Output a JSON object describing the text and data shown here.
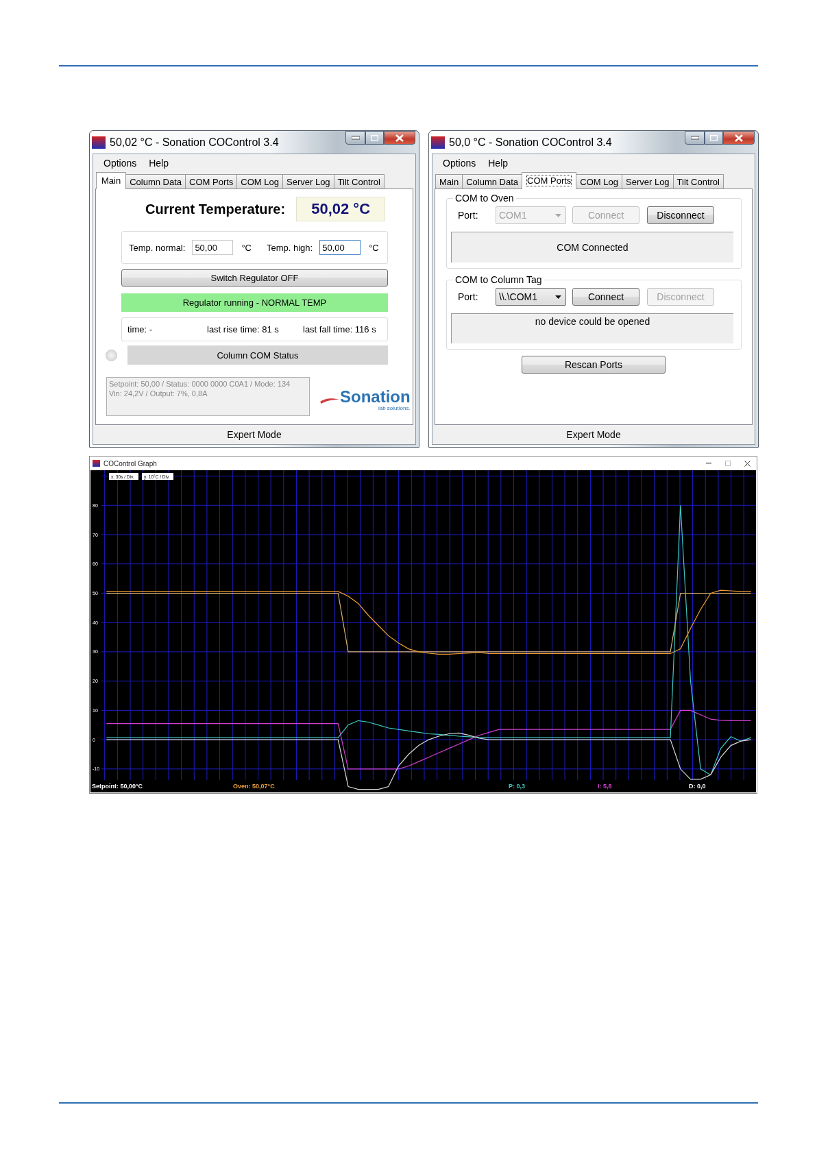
{
  "windows": [
    {
      "kind": "main",
      "title": "50,02 °C - Sonation COControl 3.4",
      "menu": [
        "Options",
        "Help"
      ],
      "tabs": [
        {
          "label": "Main",
          "selected": true
        },
        {
          "label": "Column Data",
          "selected": false
        },
        {
          "label": "COM Ports",
          "selected": false
        },
        {
          "label": "COM Log",
          "selected": false
        },
        {
          "label": "Server Log",
          "selected": false
        },
        {
          "label": "Tilt Control",
          "selected": false
        }
      ],
      "current_temperature": {
        "label": "Current Temperature:",
        "value": "50,02 °C"
      },
      "setpoints": [
        {
          "label": "Temp. normal:",
          "value": "50,00",
          "unit": "°C",
          "focused": false
        },
        {
          "label": "Temp. high:",
          "value": "50,00",
          "unit": "°C",
          "focused": true
        }
      ],
      "regulator_button": "Switch Regulator OFF",
      "regulator_status": {
        "text": "Regulator running - NORMAL TEMP",
        "running": true
      },
      "timing": [
        "time: -",
        "last rise time: 81 s",
        "last fall time: 116 s"
      ],
      "column_status": {
        "led_on": false,
        "label": "Column COM Status"
      },
      "info_lines": [
        "Setpoint: 50,00 / Status: 0000 0000 C0A1 / Mode: 134",
        "Vin: 24,2V / Output: 7%, 0,8A"
      ],
      "logo": {
        "name": "Sonation",
        "tagline": "lab solutions."
      },
      "footer": "Expert Mode"
    },
    {
      "kind": "com_ports",
      "title": "50,0 °C - Sonation COControl 3.4",
      "menu": [
        "Options",
        "Help"
      ],
      "tabs": [
        {
          "label": "Main",
          "selected": false
        },
        {
          "label": "Column Data",
          "selected": false
        },
        {
          "label": "COM Ports",
          "selected": true
        },
        {
          "label": "COM Log",
          "selected": false
        },
        {
          "label": "Server Log",
          "selected": false
        },
        {
          "label": "Tilt Control",
          "selected": false
        }
      ],
      "groups": [
        {
          "title": "COM to Oven",
          "port_label": "Port:",
          "port": {
            "value": "COM1",
            "disabled": true
          },
          "connect": {
            "label": "Connect",
            "disabled": true
          },
          "disconnect": {
            "label": "Disconnect",
            "disabled": false
          },
          "status": "COM Connected"
        },
        {
          "title": "COM to Column Tag",
          "port_label": "Port:",
          "port": {
            "value": "\\\\.\\COM1",
            "disabled": false
          },
          "connect": {
            "label": "Connect",
            "disabled": false
          },
          "disconnect": {
            "label": "Disconnect",
            "disabled": true
          },
          "status": "no device could be opened"
        }
      ],
      "rescan_button": "Rescan Ports",
      "footer": "Expert Mode"
    }
  ],
  "graph": {
    "title": "COControl Graph",
    "scale_labels": [
      "x: 30s / Div.",
      "y: 10°C / Div."
    ],
    "chart_data": {
      "type": "line",
      "grid": true,
      "ylim": [
        -18,
        92
      ],
      "yticks": [
        -10,
        0,
        10,
        20,
        30,
        40,
        50,
        60,
        70,
        80
      ],
      "categories": [
        null,
        null,
        null,
        null,
        null,
        null,
        null,
        null,
        null,
        null,
        null,
        null,
        null,
        null,
        null,
        null,
        null,
        null,
        null,
        null,
        null,
        null,
        null,
        null,
        null,
        null,
        null,
        null,
        null,
        null,
        null,
        null,
        null,
        null,
        null,
        null,
        null,
        null,
        null,
        null,
        null,
        null,
        null,
        null,
        null,
        null,
        null,
        null,
        null,
        null,
        null,
        null,
        null,
        null,
        null,
        null,
        null,
        null,
        null,
        null,
        null,
        null,
        null,
        null,
        null
      ],
      "series": [
        {
          "color": "#d8b070",
          "values": [
            50,
            50,
            50,
            50,
            50,
            50,
            50,
            50,
            50,
            50,
            50,
            50,
            50,
            50,
            50,
            50,
            50,
            50,
            50,
            50,
            50,
            50,
            50,
            50,
            30,
            30,
            30,
            30,
            30,
            30,
            30,
            30,
            30,
            30,
            30,
            30,
            30,
            30,
            30,
            30,
            30,
            30,
            30,
            30,
            30,
            30,
            30,
            30,
            30,
            30,
            30,
            30,
            30,
            30,
            30,
            30,
            30,
            50,
            50,
            50,
            50,
            50,
            50,
            50,
            50
          ]
        },
        {
          "color": "#f0a030",
          "values": [
            50.6,
            50.6,
            50.6,
            50.6,
            50.6,
            50.6,
            50.6,
            50.6,
            50.6,
            50.6,
            50.6,
            50.6,
            50.6,
            50.6,
            50.6,
            50.6,
            50.6,
            50.6,
            50.6,
            50.6,
            50.6,
            50.6,
            50.6,
            50.6,
            49,
            46.5,
            42.5,
            39,
            35.5,
            33,
            31,
            30,
            29.5,
            29.2,
            29.2,
            29.4,
            29.6,
            29.8,
            29.4,
            29.4,
            29.4,
            29.4,
            29.4,
            29.4,
            29.4,
            29.4,
            29.4,
            29.4,
            29.4,
            29.4,
            29.4,
            29.4,
            29.4,
            29.4,
            29.4,
            29.4,
            29.4,
            31,
            38,
            44.5,
            50,
            51,
            50.8,
            50.6,
            50.6
          ]
        },
        {
          "color": "#d040d0",
          "values": [
            5.5,
            5.5,
            5.5,
            5.5,
            5.5,
            5.5,
            5.5,
            5.5,
            5.5,
            5.5,
            5.5,
            5.5,
            5.5,
            5.5,
            5.5,
            5.5,
            5.5,
            5.5,
            5.5,
            5.5,
            5.5,
            5.5,
            5.5,
            5.5,
            -10,
            -10,
            -10,
            -10,
            -10,
            -10,
            -9,
            -7.5,
            -6,
            -4.5,
            -3,
            -1.5,
            0,
            1.5,
            2.5,
            3.5,
            3.5,
            3.5,
            3.5,
            3.5,
            3.5,
            3.5,
            3.5,
            3.5,
            3.5,
            3.5,
            3.5,
            3.5,
            3.5,
            3.5,
            3.5,
            3.5,
            3.5,
            10,
            10,
            8.5,
            7,
            6.6,
            6.5,
            6.5,
            6.5
          ]
        },
        {
          "color": "#40c8c0",
          "values": [
            0.7,
            0.7,
            0.7,
            0.7,
            0.7,
            0.7,
            0.7,
            0.7,
            0.7,
            0.7,
            0.7,
            0.7,
            0.7,
            0.7,
            0.7,
            0.7,
            0.7,
            0.7,
            0.7,
            0.7,
            0.7,
            0.7,
            0.7,
            0.7,
            5,
            6.5,
            6,
            5,
            4,
            3.5,
            3,
            2.5,
            2,
            1.8,
            1.5,
            1.2,
            1,
            0.8,
            0.7,
            0.7,
            0.7,
            0.7,
            0.7,
            0.7,
            0.7,
            0.7,
            0.7,
            0.7,
            0.7,
            0.7,
            0.7,
            0.7,
            0.7,
            0.7,
            0.7,
            0.7,
            0.7,
            80,
            20,
            -10,
            -12,
            -3,
            1,
            -0.5,
            0.7
          ]
        },
        {
          "color": "#d8d8d8",
          "values": [
            0,
            0,
            0,
            0,
            0,
            0,
            0,
            0,
            0,
            0,
            0,
            0,
            0,
            0,
            0,
            0,
            0,
            0,
            0,
            0,
            0,
            0,
            0,
            0,
            -16,
            -17,
            -17,
            -17,
            -16,
            -9,
            -5,
            -2,
            0,
            1.2,
            2,
            2.3,
            1.5,
            0.5,
            0,
            0,
            0,
            0,
            0,
            0,
            0,
            0,
            0,
            0,
            0,
            0,
            0,
            0,
            0,
            0,
            0,
            0,
            0,
            -10,
            -13.5,
            -13.5,
            -12,
            -6,
            -2,
            -0.5,
            0
          ]
        }
      ]
    },
    "legend": [
      {
        "text": "Setpoint: 50,00°C",
        "color": "#ffffff"
      },
      {
        "text": "Oven: 50,07°C",
        "color": "#e8a040"
      },
      {
        "text": "P: 0,3",
        "color": "#40c8c0"
      },
      {
        "text": "I: 5,8",
        "color": "#d040d0"
      },
      {
        "text": "D: 0,0",
        "color": "#ffffff"
      }
    ]
  }
}
